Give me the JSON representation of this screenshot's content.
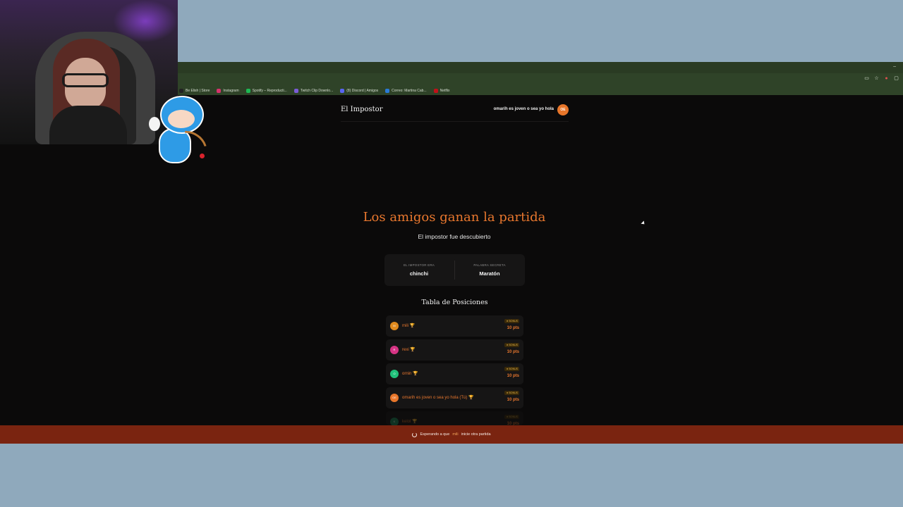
{
  "browser": {
    "bookmarks": [
      {
        "label": "Be Elish | Store",
        "color": "#222222"
      },
      {
        "label": "Instagram",
        "color": "#d6336c"
      },
      {
        "label": "Spotify – Reproducti...",
        "color": "#1db954"
      },
      {
        "label": "Twitch Clip Downlo...",
        "color": "#7b5cd6"
      },
      {
        "label": "(8) Discord | Amigos",
        "color": "#5865f2"
      },
      {
        "label": "Correo: Martina Cab...",
        "color": "#2a7ad6"
      },
      {
        "label": "Netflix",
        "color": "#c11119"
      }
    ],
    "window_control": "–"
  },
  "site": {
    "title": "El Impostor",
    "user_name": "omarih es joven o sea yo hola",
    "user_initials": "OE"
  },
  "result": {
    "title": "Los amigos ganan la partida",
    "subtitle": "El impostor fue descubierto"
  },
  "info": {
    "impostor_label": "EL IMPOSTOR ERA",
    "impostor_value": "chinchi",
    "word_label": "PALABRA SECRETA",
    "word_value": "Maratón"
  },
  "leaderboard": {
    "title": "Tabla de Posiciones",
    "rows": [
      {
        "initial": "M",
        "name": "mili",
        "trophy": "🏆",
        "badge": "★ BONUS",
        "points": "10 pts",
        "color": "#e08a1e"
      },
      {
        "initial": "R",
        "name": "rexi",
        "trophy": "🏆",
        "badge": "★ BONUS",
        "points": "10 pts",
        "color": "#d63384"
      },
      {
        "initial": "O",
        "name": "ornin",
        "trophy": "🏆",
        "badge": "★ BONUS",
        "points": "10 pts",
        "color": "#20c07a"
      },
      {
        "initial": "OE",
        "name": "omarih es joven o sea yo hola (Tú)",
        "trophy": "🏆",
        "badge": "★ BONUS",
        "points": "10 pts",
        "color": "#e8762a"
      },
      {
        "initial": "K",
        "name": "kelol",
        "trophy": "🏆",
        "badge": "★ BONUS",
        "points": "10 pts",
        "color": "#1a8f5a"
      }
    ]
  },
  "status_bar": {
    "prefix": "Esperando a que",
    "player": "mili",
    "suffix": "inicie otra partida"
  }
}
